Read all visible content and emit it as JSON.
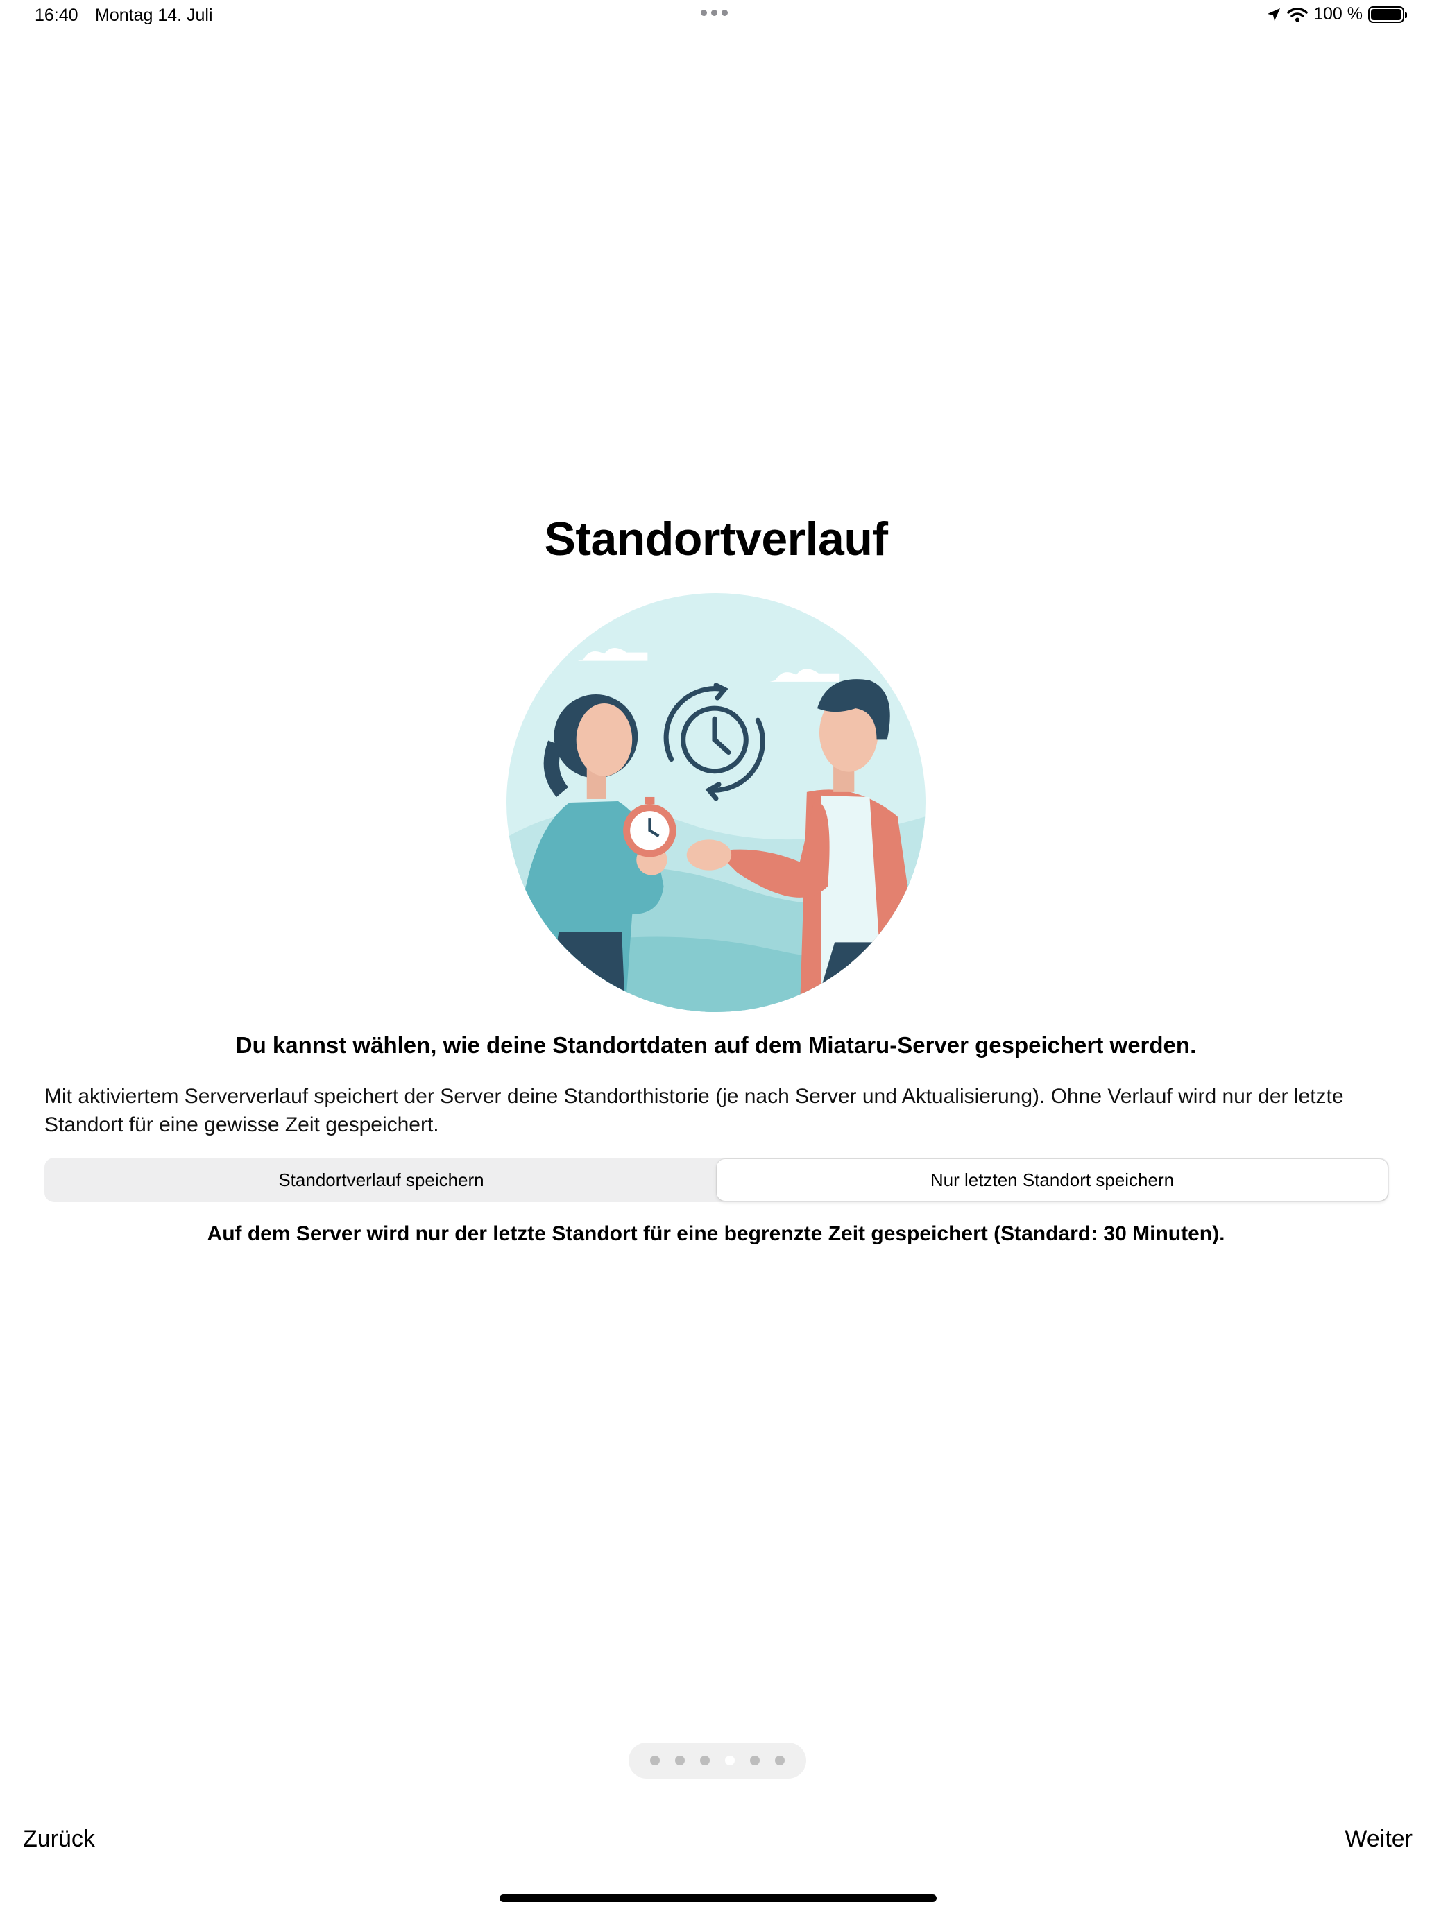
{
  "status_bar": {
    "time": "16:40",
    "date": "Montag 14. Juli",
    "battery": "100 %"
  },
  "page": {
    "title": "Standortverlauf",
    "headline": "Du kannst wählen, wie deine Standortdaten auf dem Miataru-Server gespeichert werden.",
    "body": "Mit aktiviertem Serververlauf speichert der Server deine Standorthistorie (je nach Server und Aktualisierung). Ohne Verlauf wird nur der letzte Standort für eine gewisse Zeit gespeichert.",
    "segments": [
      {
        "label": "Standortverlauf speichern",
        "selected": false
      },
      {
        "label": "Nur letzten Standort speichern",
        "selected": true
      }
    ],
    "selected_description": "Auf dem Server wird nur der letzte Standort für eine begrenzte Zeit gespeichert (Standard: 30 Minuten)."
  },
  "pager": {
    "count": 6,
    "current": 4
  },
  "navigation": {
    "back_label": "Zurück",
    "next_label": "Weiter"
  },
  "colors": {
    "illustration_bg": "#d6f1f2",
    "teal": "#5db3bd",
    "coral": "#e3816f",
    "navy": "#2b4a60"
  }
}
